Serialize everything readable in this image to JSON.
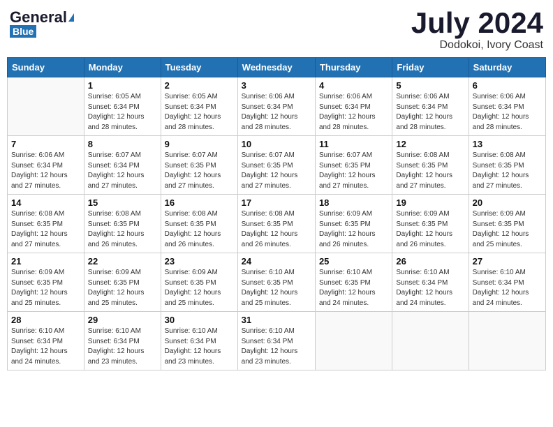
{
  "header": {
    "logo_general": "General",
    "logo_blue": "Blue",
    "title": "July 2024",
    "location": "Dodokoi, Ivory Coast"
  },
  "weekdays": [
    "Sunday",
    "Monday",
    "Tuesday",
    "Wednesday",
    "Thursday",
    "Friday",
    "Saturday"
  ],
  "weeks": [
    [
      {
        "day": "",
        "info": ""
      },
      {
        "day": "1",
        "info": "Sunrise: 6:05 AM\nSunset: 6:34 PM\nDaylight: 12 hours\nand 28 minutes."
      },
      {
        "day": "2",
        "info": "Sunrise: 6:05 AM\nSunset: 6:34 PM\nDaylight: 12 hours\nand 28 minutes."
      },
      {
        "day": "3",
        "info": "Sunrise: 6:06 AM\nSunset: 6:34 PM\nDaylight: 12 hours\nand 28 minutes."
      },
      {
        "day": "4",
        "info": "Sunrise: 6:06 AM\nSunset: 6:34 PM\nDaylight: 12 hours\nand 28 minutes."
      },
      {
        "day": "5",
        "info": "Sunrise: 6:06 AM\nSunset: 6:34 PM\nDaylight: 12 hours\nand 28 minutes."
      },
      {
        "day": "6",
        "info": "Sunrise: 6:06 AM\nSunset: 6:34 PM\nDaylight: 12 hours\nand 28 minutes."
      }
    ],
    [
      {
        "day": "7",
        "info": "Sunrise: 6:06 AM\nSunset: 6:34 PM\nDaylight: 12 hours\nand 27 minutes."
      },
      {
        "day": "8",
        "info": "Sunrise: 6:07 AM\nSunset: 6:34 PM\nDaylight: 12 hours\nand 27 minutes."
      },
      {
        "day": "9",
        "info": "Sunrise: 6:07 AM\nSunset: 6:35 PM\nDaylight: 12 hours\nand 27 minutes."
      },
      {
        "day": "10",
        "info": "Sunrise: 6:07 AM\nSunset: 6:35 PM\nDaylight: 12 hours\nand 27 minutes."
      },
      {
        "day": "11",
        "info": "Sunrise: 6:07 AM\nSunset: 6:35 PM\nDaylight: 12 hours\nand 27 minutes."
      },
      {
        "day": "12",
        "info": "Sunrise: 6:08 AM\nSunset: 6:35 PM\nDaylight: 12 hours\nand 27 minutes."
      },
      {
        "day": "13",
        "info": "Sunrise: 6:08 AM\nSunset: 6:35 PM\nDaylight: 12 hours\nand 27 minutes."
      }
    ],
    [
      {
        "day": "14",
        "info": "Sunrise: 6:08 AM\nSunset: 6:35 PM\nDaylight: 12 hours\nand 27 minutes."
      },
      {
        "day": "15",
        "info": "Sunrise: 6:08 AM\nSunset: 6:35 PM\nDaylight: 12 hours\nand 26 minutes."
      },
      {
        "day": "16",
        "info": "Sunrise: 6:08 AM\nSunset: 6:35 PM\nDaylight: 12 hours\nand 26 minutes."
      },
      {
        "day": "17",
        "info": "Sunrise: 6:08 AM\nSunset: 6:35 PM\nDaylight: 12 hours\nand 26 minutes."
      },
      {
        "day": "18",
        "info": "Sunrise: 6:09 AM\nSunset: 6:35 PM\nDaylight: 12 hours\nand 26 minutes."
      },
      {
        "day": "19",
        "info": "Sunrise: 6:09 AM\nSunset: 6:35 PM\nDaylight: 12 hours\nand 26 minutes."
      },
      {
        "day": "20",
        "info": "Sunrise: 6:09 AM\nSunset: 6:35 PM\nDaylight: 12 hours\nand 25 minutes."
      }
    ],
    [
      {
        "day": "21",
        "info": "Sunrise: 6:09 AM\nSunset: 6:35 PM\nDaylight: 12 hours\nand 25 minutes."
      },
      {
        "day": "22",
        "info": "Sunrise: 6:09 AM\nSunset: 6:35 PM\nDaylight: 12 hours\nand 25 minutes."
      },
      {
        "day": "23",
        "info": "Sunrise: 6:09 AM\nSunset: 6:35 PM\nDaylight: 12 hours\nand 25 minutes."
      },
      {
        "day": "24",
        "info": "Sunrise: 6:10 AM\nSunset: 6:35 PM\nDaylight: 12 hours\nand 25 minutes."
      },
      {
        "day": "25",
        "info": "Sunrise: 6:10 AM\nSunset: 6:35 PM\nDaylight: 12 hours\nand 24 minutes."
      },
      {
        "day": "26",
        "info": "Sunrise: 6:10 AM\nSunset: 6:34 PM\nDaylight: 12 hours\nand 24 minutes."
      },
      {
        "day": "27",
        "info": "Sunrise: 6:10 AM\nSunset: 6:34 PM\nDaylight: 12 hours\nand 24 minutes."
      }
    ],
    [
      {
        "day": "28",
        "info": "Sunrise: 6:10 AM\nSunset: 6:34 PM\nDaylight: 12 hours\nand 24 minutes."
      },
      {
        "day": "29",
        "info": "Sunrise: 6:10 AM\nSunset: 6:34 PM\nDaylight: 12 hours\nand 23 minutes."
      },
      {
        "day": "30",
        "info": "Sunrise: 6:10 AM\nSunset: 6:34 PM\nDaylight: 12 hours\nand 23 minutes."
      },
      {
        "day": "31",
        "info": "Sunrise: 6:10 AM\nSunset: 6:34 PM\nDaylight: 12 hours\nand 23 minutes."
      },
      {
        "day": "",
        "info": ""
      },
      {
        "day": "",
        "info": ""
      },
      {
        "day": "",
        "info": ""
      }
    ]
  ]
}
